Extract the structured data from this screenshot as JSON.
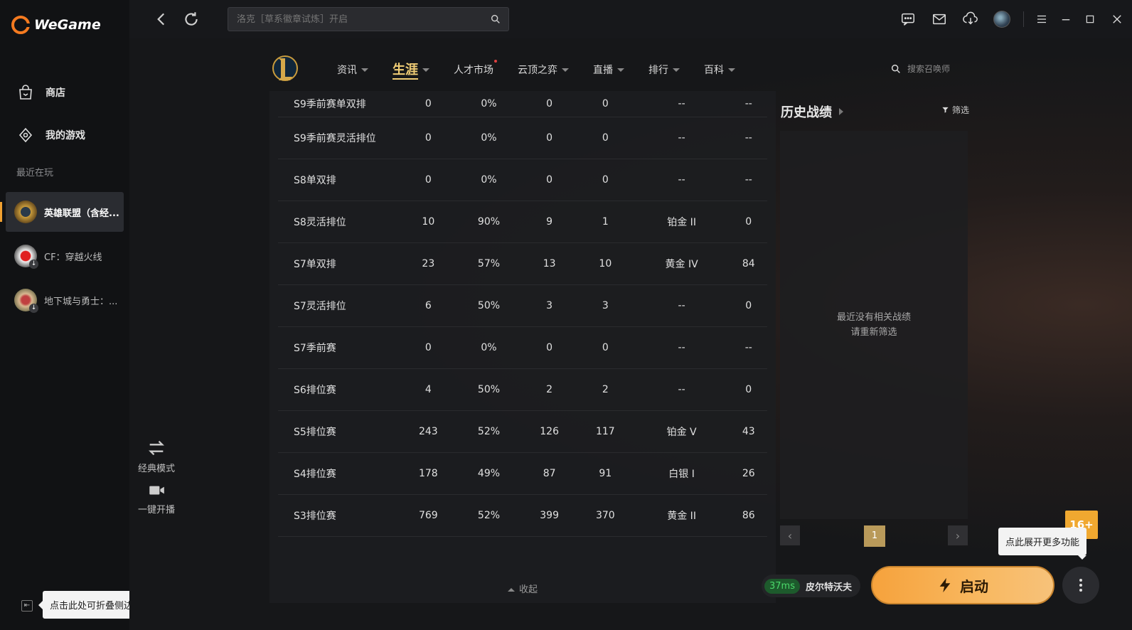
{
  "app": {
    "name": "WeGame"
  },
  "sidebar": {
    "nav": [
      {
        "label": "商店"
      },
      {
        "label": "我的游戏"
      }
    ],
    "recent_label": "最近在玩",
    "recent": [
      {
        "label": "英雄联盟（含经..."
      },
      {
        "label": "CF：穿越火线"
      },
      {
        "label": "地下城与勇士：..."
      }
    ],
    "collapse_tooltip": "点击此处可折叠侧边栏"
  },
  "topbar": {
    "search_placeholder": "洛克［草系徽章试炼］开启"
  },
  "game_nav": {
    "tabs": [
      {
        "label": "资讯"
      },
      {
        "label": "生涯"
      },
      {
        "label": "人才市场"
      },
      {
        "label": "云顶之弈"
      },
      {
        "label": "直播"
      },
      {
        "label": "排行"
      },
      {
        "label": "百科"
      }
    ],
    "summoner_search_placeholder": "搜索召唤师"
  },
  "tools": {
    "mode_label": "经典模式",
    "stream_label": "一键开播"
  },
  "stats": {
    "rows": [
      [
        "S9季前赛单双排",
        "0",
        "0%",
        "0",
        "0",
        "--",
        "--"
      ],
      [
        "S9季前赛灵活排位",
        "0",
        "0%",
        "0",
        "0",
        "--",
        "--"
      ],
      [
        "S8单双排",
        "0",
        "0%",
        "0",
        "0",
        "--",
        "--"
      ],
      [
        "S8灵活排位",
        "10",
        "90%",
        "9",
        "1",
        "铂金 II",
        "0"
      ],
      [
        "S7单双排",
        "23",
        "57%",
        "13",
        "10",
        "黄金 IV",
        "84"
      ],
      [
        "S7灵活排位",
        "6",
        "50%",
        "3",
        "3",
        "--",
        "0"
      ],
      [
        "S7季前赛",
        "0",
        "0%",
        "0",
        "0",
        "--",
        "--"
      ],
      [
        "S6排位赛",
        "4",
        "50%",
        "2",
        "2",
        "--",
        "0"
      ],
      [
        "S5排位赛",
        "243",
        "52%",
        "126",
        "117",
        "铂金 V",
        "43"
      ],
      [
        "S4排位赛",
        "178",
        "49%",
        "87",
        "91",
        "白银 I",
        "26"
      ],
      [
        "S3排位赛",
        "769",
        "52%",
        "399",
        "370",
        "黄金 II",
        "86"
      ]
    ],
    "collapse_label": "收起"
  },
  "history": {
    "title": "历史战绩",
    "filter_label": "筛选",
    "empty_line1": "最近没有相关战绩",
    "empty_line2": "请重新筛选",
    "page": "1"
  },
  "launch": {
    "ping": "37ms",
    "server": "皮尔特沃夫",
    "button_label": "启动",
    "more_tooltip": "点此展开更多功能",
    "age_badge": "16+"
  },
  "colors": {
    "accent": "#f0cd75",
    "launch": "#f6a23c",
    "brand": "#f47a20"
  }
}
